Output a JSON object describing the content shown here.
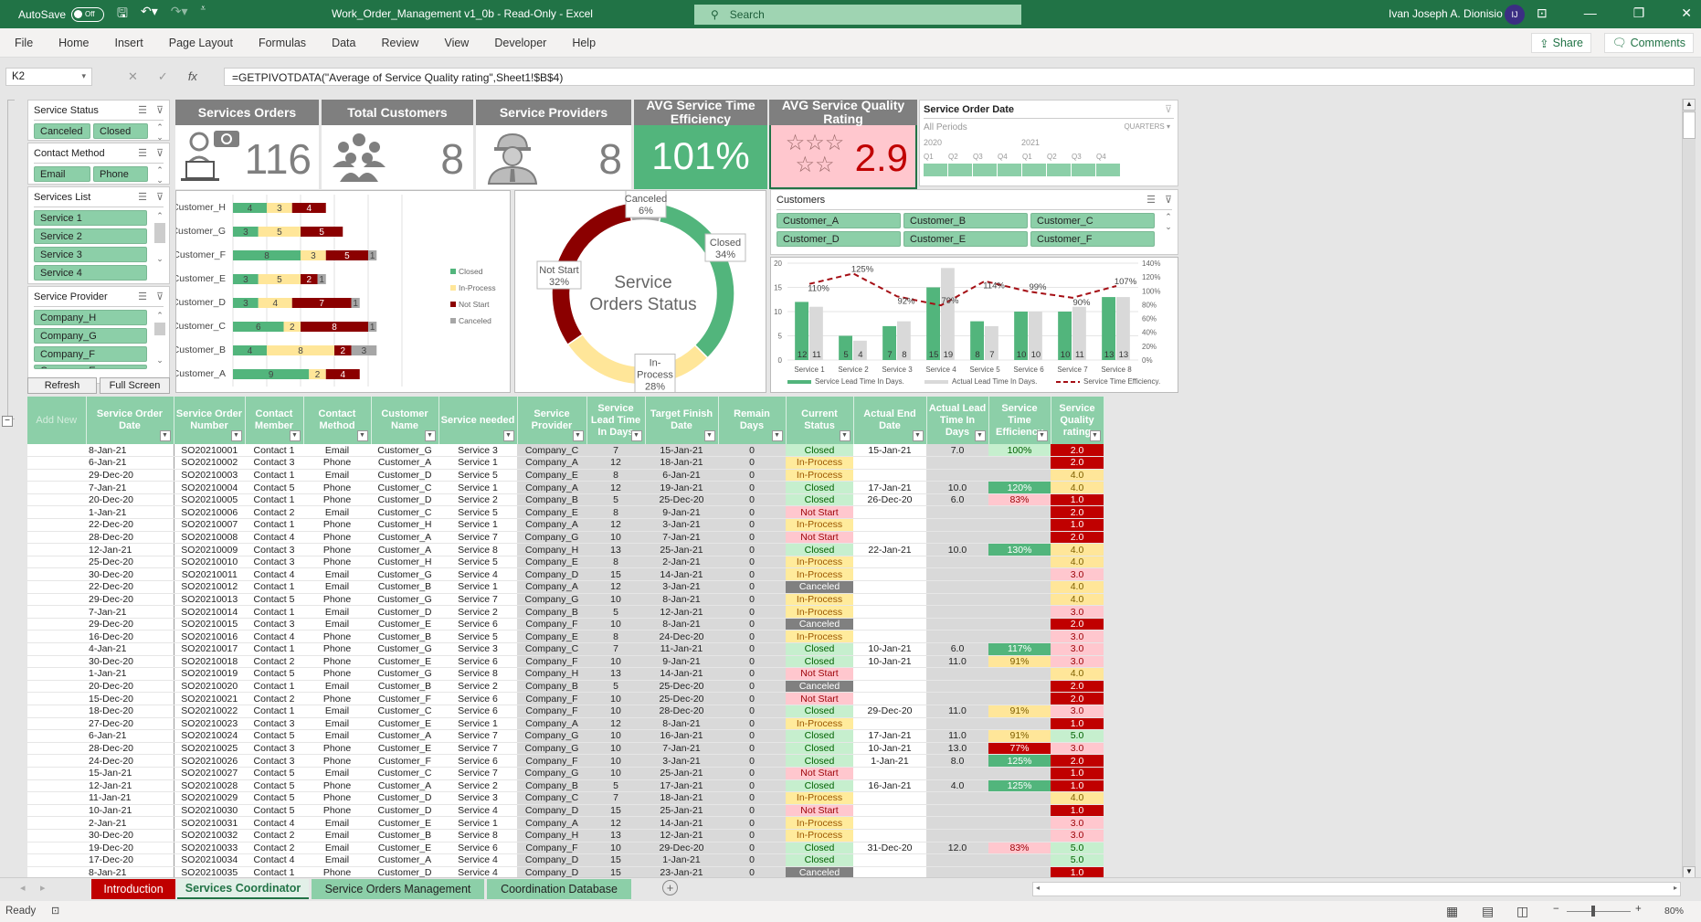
{
  "titlebar": {
    "autosave_label": "AutoSave",
    "autosave_state": "Off",
    "title": "Work_Order_Management v1_0b  -  Read-Only  -  Excel",
    "search_placeholder": "Search",
    "user_name": "Ivan Joseph A. Dionisio",
    "user_initials": "IJ"
  },
  "ribbon": {
    "tabs": [
      "File",
      "Home",
      "Insert",
      "Page Layout",
      "Formulas",
      "Data",
      "Review",
      "View",
      "Developer",
      "Help"
    ],
    "share_label": "Share",
    "comments_label": "Comments"
  },
  "formula_bar": {
    "name_box": "K2",
    "formula": "=GETPIVOTDATA(\"Average of Service Quality rating\",Sheet1!$B$4)"
  },
  "slicers": {
    "service_status": {
      "title": "Service Status",
      "items": [
        "Canceled",
        "Closed"
      ]
    },
    "contact_method": {
      "title": "Contact Method",
      "items": [
        "Email",
        "Phone"
      ]
    },
    "services_list": {
      "title": "Services List",
      "items": [
        "Service 1",
        "Service 2",
        "Service 3",
        "Service 4"
      ]
    },
    "service_provider": {
      "title": "Service Provider",
      "items": [
        "Company_H",
        "Company_G",
        "Company_F",
        "Company_E"
      ]
    },
    "customers": {
      "title": "Customers",
      "items": [
        "Customer_A",
        "Customer_B",
        "Customer_C",
        "Customer_D",
        "Customer_E",
        "Customer_F"
      ]
    },
    "order_date": {
      "title": "Service Order Date",
      "period": "All Periods",
      "granularity": "QUARTERS",
      "years": [
        "2020",
        "2021"
      ],
      "quarters": [
        "Q1",
        "Q2",
        "Q3",
        "Q4",
        "Q1",
        "Q2",
        "Q3",
        "Q4"
      ]
    }
  },
  "buttons": {
    "refresh": "Refresh",
    "full_screen": "Full Screen",
    "add_new": "Add New"
  },
  "kpis": {
    "service_orders": {
      "label": "Services Orders",
      "value": "116"
    },
    "total_customers": {
      "label": "Total Customers",
      "value": "8"
    },
    "service_providers": {
      "label": "Service Providers",
      "value": "8"
    },
    "time_efficiency": {
      "label": "AVG Service Time Efficiency",
      "value": "101%"
    },
    "quality_rating": {
      "label": "AVG Service Quality Rating",
      "value": "2.9",
      "stars": 5
    }
  },
  "colors": {
    "closed": "#52b57c",
    "in_process": "#ffe699",
    "not_start": "#8b0000",
    "canceled": "#a6a6a6",
    "header_green": "#8ccfa8",
    "kpi_grey": "#7f7f7f"
  },
  "chart_data": [
    {
      "type": "bar",
      "orientation": "horizontal-stacked",
      "categories": [
        "Customer_H",
        "Customer_G",
        "Customer_F",
        "Customer_E",
        "Customer_D",
        "Customer_C",
        "Customer_B",
        "Customer_A"
      ],
      "series": [
        {
          "name": "Closed",
          "values": [
            4,
            3,
            8,
            3,
            3,
            6,
            4,
            9
          ]
        },
        {
          "name": "In-Process",
          "values": [
            3,
            5,
            3,
            5,
            4,
            2,
            8,
            2
          ]
        },
        {
          "name": "Not Start",
          "values": [
            4,
            5,
            5,
            2,
            7,
            8,
            2,
            4
          ]
        },
        {
          "name": "Canceled",
          "values": [
            0,
            0,
            1,
            1,
            1,
            1,
            3,
            0
          ]
        }
      ],
      "xlim": [
        0,
        25
      ],
      "grid": true,
      "legend": "right"
    },
    {
      "type": "pie",
      "variant": "doughnut",
      "title": "Service Orders Status",
      "categories": [
        "Closed",
        "In-Process",
        "Not Start",
        "Canceled"
      ],
      "values": [
        34,
        28,
        32,
        6
      ],
      "labels": [
        "Closed\n34%",
        "In-\nProcess\n28%",
        "Not Start\n32%",
        "Canceled\n6%"
      ]
    },
    {
      "type": "bar",
      "variant": "combo-bar-line",
      "categories": [
        "Service 1",
        "Service 2",
        "Service 3",
        "Service 4",
        "Service 5",
        "Service 6",
        "Service 7",
        "Service 8"
      ],
      "series": [
        {
          "name": "Service Lead Time In Days.",
          "type": "bar",
          "axis": "left",
          "values": [
            12,
            5,
            7,
            15,
            8,
            10,
            10,
            13
          ]
        },
        {
          "name": "Actual Lead Time In Days.",
          "type": "bar",
          "axis": "left",
          "values": [
            11,
            4,
            8,
            19,
            7,
            10,
            11,
            13
          ]
        },
        {
          "name": "Service Time Efficiency.",
          "type": "line",
          "axis": "right",
          "values": [
            110,
            125,
            92,
            79,
            114,
            99,
            90,
            107
          ],
          "labels": [
            "110%",
            "125%",
            "92%",
            "79%",
            "114%",
            "99%",
            "90%",
            "107%"
          ]
        }
      ],
      "ylim": [
        0,
        20
      ],
      "yticks": [
        0,
        5,
        10,
        15,
        20
      ],
      "y2lim": [
        0,
        140
      ],
      "y2ticks": [
        "0%",
        "20%",
        "40%",
        "60%",
        "80%",
        "100%",
        "120%",
        "140%"
      ],
      "grid": true,
      "legend": "bottom"
    }
  ],
  "table": {
    "columns": [
      "Service Order Date",
      "Service Order Number",
      "Contact Member",
      "Contact Method",
      "Customer Name",
      "Service needed",
      "Service Provider",
      "Service Lead Time In Days",
      "Target Finish Date",
      "Remain Days",
      "Current Status",
      "Actual End Date",
      "Actual Lead Time In Days",
      "Service Time Efficiency",
      "Service Quality rating"
    ],
    "rows": [
      [
        "8-Jan-21",
        "SO20210001",
        "Contact 1",
        "Email",
        "Customer_G",
        "Service 3",
        "Company_C",
        "7",
        "15-Jan-21",
        "0",
        "Closed",
        "15-Jan-21",
        "7.0",
        "100%",
        "2.0"
      ],
      [
        "6-Jan-21",
        "SO20210002",
        "Contact 3",
        "Phone",
        "Customer_A",
        "Service 1",
        "Company_A",
        "12",
        "18-Jan-21",
        "0",
        "In-Process",
        "",
        "",
        "",
        "2.0"
      ],
      [
        "29-Dec-20",
        "SO20210003",
        "Contact 1",
        "Email",
        "Customer_D",
        "Service 5",
        "Company_E",
        "8",
        "6-Jan-21",
        "0",
        "In-Process",
        "",
        "",
        "",
        "4.0"
      ],
      [
        "7-Jan-21",
        "SO20210004",
        "Contact 5",
        "Phone",
        "Customer_C",
        "Service 1",
        "Company_A",
        "12",
        "19-Jan-21",
        "0",
        "Closed",
        "17-Jan-21",
        "10.0",
        "120%",
        "4.0"
      ],
      [
        "20-Dec-20",
        "SO20210005",
        "Contact 1",
        "Phone",
        "Customer_D",
        "Service 2",
        "Company_B",
        "5",
        "25-Dec-20",
        "0",
        "Closed",
        "26-Dec-20",
        "6.0",
        "83%",
        "1.0"
      ],
      [
        "1-Jan-21",
        "SO20210006",
        "Contact 2",
        "Email",
        "Customer_C",
        "Service 5",
        "Company_E",
        "8",
        "9-Jan-21",
        "0",
        "Not Start",
        "",
        "",
        "",
        "2.0"
      ],
      [
        "22-Dec-20",
        "SO20210007",
        "Contact 1",
        "Phone",
        "Customer_H",
        "Service 1",
        "Company_A",
        "12",
        "3-Jan-21",
        "0",
        "In-Process",
        "",
        "",
        "",
        "1.0"
      ],
      [
        "28-Dec-20",
        "SO20210008",
        "Contact 4",
        "Phone",
        "Customer_A",
        "Service 7",
        "Company_G",
        "10",
        "7-Jan-21",
        "0",
        "Not Start",
        "",
        "",
        "",
        "2.0"
      ],
      [
        "12-Jan-21",
        "SO20210009",
        "Contact 3",
        "Phone",
        "Customer_A",
        "Service 8",
        "Company_H",
        "13",
        "25-Jan-21",
        "0",
        "Closed",
        "22-Jan-21",
        "10.0",
        "130%",
        "4.0"
      ],
      [
        "25-Dec-20",
        "SO20210010",
        "Contact 3",
        "Phone",
        "Customer_H",
        "Service 5",
        "Company_E",
        "8",
        "2-Jan-21",
        "0",
        "In-Process",
        "",
        "",
        "",
        "4.0"
      ],
      [
        "30-Dec-20",
        "SO20210011",
        "Contact 4",
        "Email",
        "Customer_G",
        "Service 4",
        "Company_D",
        "15",
        "14-Jan-21",
        "0",
        "In-Process",
        "",
        "",
        "",
        "3.0"
      ],
      [
        "22-Dec-20",
        "SO20210012",
        "Contact 1",
        "Email",
        "Customer_B",
        "Service 1",
        "Company_A",
        "12",
        "3-Jan-21",
        "0",
        "Canceled",
        "",
        "",
        "",
        "4.0"
      ],
      [
        "29-Dec-20",
        "SO20210013",
        "Contact 5",
        "Phone",
        "Customer_G",
        "Service 7",
        "Company_G",
        "10",
        "8-Jan-21",
        "0",
        "In-Process",
        "",
        "",
        "",
        "4.0"
      ],
      [
        "7-Jan-21",
        "SO20210014",
        "Contact 1",
        "Email",
        "Customer_D",
        "Service 2",
        "Company_B",
        "5",
        "12-Jan-21",
        "0",
        "In-Process",
        "",
        "",
        "",
        "3.0"
      ],
      [
        "29-Dec-20",
        "SO20210015",
        "Contact 3",
        "Email",
        "Customer_E",
        "Service 6",
        "Company_F",
        "10",
        "8-Jan-21",
        "0",
        "Canceled",
        "",
        "",
        "",
        "2.0"
      ],
      [
        "16-Dec-20",
        "SO20210016",
        "Contact 4",
        "Phone",
        "Customer_B",
        "Service 5",
        "Company_E",
        "8",
        "24-Dec-20",
        "0",
        "In-Process",
        "",
        "",
        "",
        "3.0"
      ],
      [
        "4-Jan-21",
        "SO20210017",
        "Contact 1",
        "Phone",
        "Customer_G",
        "Service 3",
        "Company_C",
        "7",
        "11-Jan-21",
        "0",
        "Closed",
        "10-Jan-21",
        "6.0",
        "117%",
        "3.0"
      ],
      [
        "30-Dec-20",
        "SO20210018",
        "Contact 2",
        "Phone",
        "Customer_E",
        "Service 6",
        "Company_F",
        "10",
        "9-Jan-21",
        "0",
        "Closed",
        "10-Jan-21",
        "11.0",
        "91%",
        "3.0"
      ],
      [
        "1-Jan-21",
        "SO20210019",
        "Contact 5",
        "Phone",
        "Customer_G",
        "Service 8",
        "Company_H",
        "13",
        "14-Jan-21",
        "0",
        "Not Start",
        "",
        "",
        "",
        "4.0"
      ],
      [
        "20-Dec-20",
        "SO20210020",
        "Contact 1",
        "Email",
        "Customer_B",
        "Service 2",
        "Company_B",
        "5",
        "25-Dec-20",
        "0",
        "Canceled",
        "",
        "",
        "",
        "2.0"
      ],
      [
        "15-Dec-20",
        "SO20210021",
        "Contact 2",
        "Phone",
        "Customer_F",
        "Service 6",
        "Company_F",
        "10",
        "25-Dec-20",
        "0",
        "Not Start",
        "",
        "",
        "",
        "2.0"
      ],
      [
        "18-Dec-20",
        "SO20210022",
        "Contact 1",
        "Email",
        "Customer_C",
        "Service 6",
        "Company_F",
        "10",
        "28-Dec-20",
        "0",
        "Closed",
        "29-Dec-20",
        "11.0",
        "91%",
        "3.0"
      ],
      [
        "27-Dec-20",
        "SO20210023",
        "Contact 3",
        "Email",
        "Customer_E",
        "Service 1",
        "Company_A",
        "12",
        "8-Jan-21",
        "0",
        "In-Process",
        "",
        "",
        "",
        "1.0"
      ],
      [
        "6-Jan-21",
        "SO20210024",
        "Contact 5",
        "Email",
        "Customer_A",
        "Service 7",
        "Company_G",
        "10",
        "16-Jan-21",
        "0",
        "Closed",
        "17-Jan-21",
        "11.0",
        "91%",
        "5.0"
      ],
      [
        "28-Dec-20",
        "SO20210025",
        "Contact 3",
        "Phone",
        "Customer_E",
        "Service 7",
        "Company_G",
        "10",
        "7-Jan-21",
        "0",
        "Closed",
        "10-Jan-21",
        "13.0",
        "77%",
        "3.0"
      ],
      [
        "24-Dec-20",
        "SO20210026",
        "Contact 3",
        "Phone",
        "Customer_F",
        "Service 6",
        "Company_F",
        "10",
        "3-Jan-21",
        "0",
        "Closed",
        "1-Jan-21",
        "8.0",
        "125%",
        "2.0"
      ],
      [
        "15-Jan-21",
        "SO20210027",
        "Contact 5",
        "Email",
        "Customer_C",
        "Service 7",
        "Company_G",
        "10",
        "25-Jan-21",
        "0",
        "Not Start",
        "",
        "",
        "",
        "1.0"
      ],
      [
        "12-Jan-21",
        "SO20210028",
        "Contact 5",
        "Phone",
        "Customer_A",
        "Service 2",
        "Company_B",
        "5",
        "17-Jan-21",
        "0",
        "Closed",
        "16-Jan-21",
        "4.0",
        "125%",
        "1.0"
      ],
      [
        "11-Jan-21",
        "SO20210029",
        "Contact 5",
        "Phone",
        "Customer_D",
        "Service 3",
        "Company_C",
        "7",
        "18-Jan-21",
        "0",
        "In-Process",
        "",
        "",
        "",
        "4.0"
      ],
      [
        "10-Jan-21",
        "SO20210030",
        "Contact 5",
        "Phone",
        "Customer_D",
        "Service 4",
        "Company_D",
        "15",
        "25-Jan-21",
        "0",
        "Not Start",
        "",
        "",
        "",
        "1.0"
      ],
      [
        "2-Jan-21",
        "SO20210031",
        "Contact 4",
        "Email",
        "Customer_E",
        "Service 1",
        "Company_A",
        "12",
        "14-Jan-21",
        "0",
        "In-Process",
        "",
        "",
        "",
        "3.0"
      ],
      [
        "30-Dec-20",
        "SO20210032",
        "Contact 2",
        "Email",
        "Customer_B",
        "Service 8",
        "Company_H",
        "13",
        "12-Jan-21",
        "0",
        "In-Process",
        "",
        "",
        "",
        "3.0"
      ],
      [
        "19-Dec-20",
        "SO20210033",
        "Contact 2",
        "Email",
        "Customer_E",
        "Service 6",
        "Company_F",
        "10",
        "29-Dec-20",
        "0",
        "Closed",
        "31-Dec-20",
        "12.0",
        "83%",
        "5.0"
      ],
      [
        "17-Dec-20",
        "SO20210034",
        "Contact 4",
        "Email",
        "Customer_A",
        "Service 4",
        "Company_D",
        "15",
        "1-Jan-21",
        "0",
        "Closed",
        "",
        "",
        "",
        "5.0"
      ],
      [
        "8-Jan-21",
        "SO20210035",
        "Contact 1",
        "Phone",
        "Customer_D",
        "Service 4",
        "Company_D",
        "15",
        "23-Jan-21",
        "0",
        "Canceled",
        "",
        "",
        "",
        "1.0"
      ]
    ]
  },
  "sheet_tabs": [
    {
      "label": "Introduction",
      "color": "#c00000",
      "text": "#ffffff"
    },
    {
      "label": "Services Coordinator",
      "color": "#e2f0e8",
      "text": "#217346",
      "active": true
    },
    {
      "label": "Service Orders Management",
      "color": "#8ccfa8",
      "text": "#222222"
    },
    {
      "label": "Coordination Database",
      "color": "#8ccfa8",
      "text": "#222222"
    }
  ],
  "status": {
    "ready": "Ready",
    "zoom": "80%"
  }
}
